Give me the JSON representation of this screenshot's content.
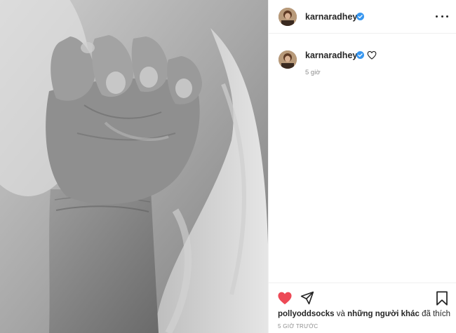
{
  "post": {
    "image_alt": "Baby hand (black & white photo)",
    "header": {
      "username": "karnaradheya",
      "more_icon": "more-horizontal-icon"
    },
    "caption": {
      "username": "karnaradheya",
      "timestamp": "5 giờ"
    },
    "actions": {
      "like_icon": "heart-filled-icon",
      "share_icon": "send-icon",
      "save_icon": "bookmark-icon"
    },
    "likes": {
      "user": "pollyoddsocks",
      "connector": "và",
      "others": "những người khác",
      "suffix": "đã thích"
    },
    "posted_time": "5 GIỜ TRƯỚC"
  },
  "colors": {
    "like": "#ed4956",
    "verified": "#3897f0",
    "muted": "#8e8e8e",
    "border": "#efefef"
  }
}
